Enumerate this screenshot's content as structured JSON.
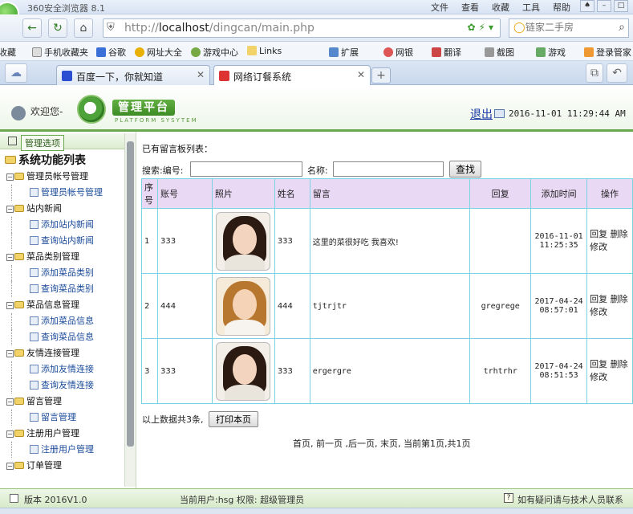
{
  "browser": {
    "app_title": "360安全浏览器 8.1",
    "menus": [
      "文件",
      "查看",
      "收藏",
      "工具",
      "帮助"
    ],
    "url_host": "localhost",
    "url_path": "/dingcan/main.php",
    "url_scheme": "http://",
    "search_placeholder": "链家二手房",
    "favorites": [
      "收藏",
      "手机收藏夹",
      "谷歌",
      "网址大全",
      "游戏中心",
      "Links",
      "扩展",
      "网银",
      "翻译",
      "截图",
      "游戏",
      "登录管家"
    ],
    "tabs": [
      {
        "title": "百度一下，你就知道",
        "active": false
      },
      {
        "title": "网络订餐系统",
        "active": true
      }
    ]
  },
  "header": {
    "welcome": "欢迎您-",
    "title": "管理平台",
    "subtitle": "PLATFORM SYSYTEM",
    "logout": "退出",
    "datetime": "2016-11-01 11:29:44 AM"
  },
  "sidebar": {
    "header_label": "管理选项",
    "root": "系统功能列表",
    "groups": [
      {
        "label": "管理员帐号管理",
        "items": [
          "管理员帐号管理"
        ]
      },
      {
        "label": "站内新闻",
        "items": [
          "添加站内新闻",
          "查询站内新闻"
        ]
      },
      {
        "label": "菜品类别管理",
        "items": [
          "添加菜品类别",
          "查询菜品类别"
        ]
      },
      {
        "label": "菜品信息管理",
        "items": [
          "添加菜品信息",
          "查询菜品信息"
        ]
      },
      {
        "label": "友情连接管理",
        "items": [
          "添加友情连接",
          "查询友情连接"
        ]
      },
      {
        "label": "留言管理",
        "items": [
          "留言管理"
        ]
      },
      {
        "label": "注册用户管理",
        "items": [
          "注册用户管理"
        ]
      },
      {
        "label": "订单管理",
        "items": []
      }
    ]
  },
  "main": {
    "list_title": "已有留言板列表：",
    "search": {
      "label_id": "搜索:编号:",
      "label_name": "名称:",
      "button": "查找",
      "id_value": "",
      "name_value": ""
    },
    "columns": [
      "序号",
      "账号",
      "照片",
      "姓名",
      "留言",
      "回复",
      "添加时间",
      "操作"
    ],
    "rows": [
      {
        "no": "1",
        "account": "333",
        "name": "333",
        "message": "这里的菜很好吃 我喜欢!",
        "reply": "",
        "date": "2016-11-01",
        "time": "11:25:35",
        "photo": "female"
      },
      {
        "no": "2",
        "account": "444",
        "name": "444",
        "message": "tjtrjtr",
        "reply": "gregrege",
        "date": "2017-04-24",
        "time": "08:57:01",
        "photo": "male"
      },
      {
        "no": "3",
        "account": "333",
        "name": "333",
        "message": "ergergre",
        "reply": "trhtrhr",
        "date": "2017-04-24",
        "time": "08:51:53",
        "photo": "female"
      }
    ],
    "ops": {
      "reply": "回复",
      "delete": "删除",
      "edit": "修改"
    },
    "summary": "以上数据共3条,",
    "print_button": "打印本页",
    "pager": "首页, 前一页 ,后一页, 末页, 当前第1页,共1页"
  },
  "status": {
    "version": "版本 2016V1.0",
    "current_user": "当前用户:hsg 权限: 超级管理员",
    "help": "如有疑问请与技术人员联系"
  },
  "colors": {
    "accent_green": "#6aa84f",
    "table_border": "#79d3e3",
    "table_header_bg": "#ead9f5"
  }
}
